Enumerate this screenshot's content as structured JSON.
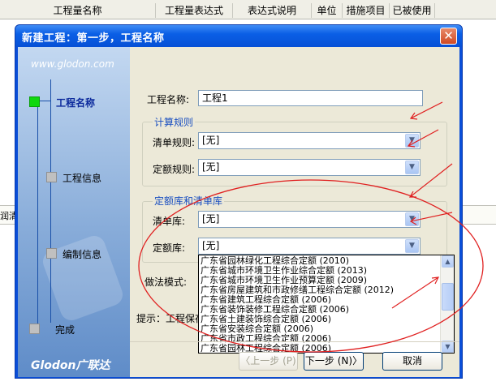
{
  "background": {
    "columns": [
      "工程量名称",
      "工程量表达式",
      "表达式说明",
      "单位",
      "措施项目",
      "已被使用"
    ],
    "strip_text": "润清"
  },
  "dialog": {
    "title": "新建工程：第一步，工程名称",
    "close_label": "✕"
  },
  "sidebar": {
    "url": "www.glodon.com",
    "steps": [
      {
        "label": "工程名称",
        "active": true
      },
      {
        "label": "工程信息",
        "active": false
      },
      {
        "label": "编制信息",
        "active": false
      },
      {
        "label": "完成",
        "active": false
      }
    ],
    "logo": "Glodon广联达"
  },
  "form": {
    "project_name_label": "工程名称:",
    "project_name_value": "工程1",
    "calc_rules_title": "计算规则",
    "list_rule_label": "清单规则:",
    "list_rule_value": "[无]",
    "quota_rule_label": "定额规则:",
    "quota_rule_value": "[无]",
    "library_title": "定额库和清单库",
    "list_lib_label": "清单库:",
    "list_lib_value": "[无]",
    "quota_lib_label": "定额库:",
    "quota_lib_value": "[无]",
    "mode_label": "做法模式:",
    "hint_text": "提示：工程保存"
  },
  "dropdown": {
    "options": [
      "广东省园林绿化工程综合定额 (2010)",
      "广东省城市环境卫生作业综合定额 (2013)",
      "广东省城市环境卫生作业预算定额 (2009)",
      "广东省房屋建筑和市政修缮工程综合定额 (2012)",
      "广东省建筑工程综合定额 (2006)",
      "广东省装饰装修工程综合定额 (2006)",
      "广东省土建装饰综合定额 (2006)",
      "广东省安装综合定额 (2006)",
      "广东省市政工程综合定额 (2006)",
      "广东省园林工程综合定额 (2006)"
    ]
  },
  "buttons": {
    "prev": "〈上一步 (P)",
    "next": "下一步 (N)〉",
    "cancel": "取消"
  }
}
